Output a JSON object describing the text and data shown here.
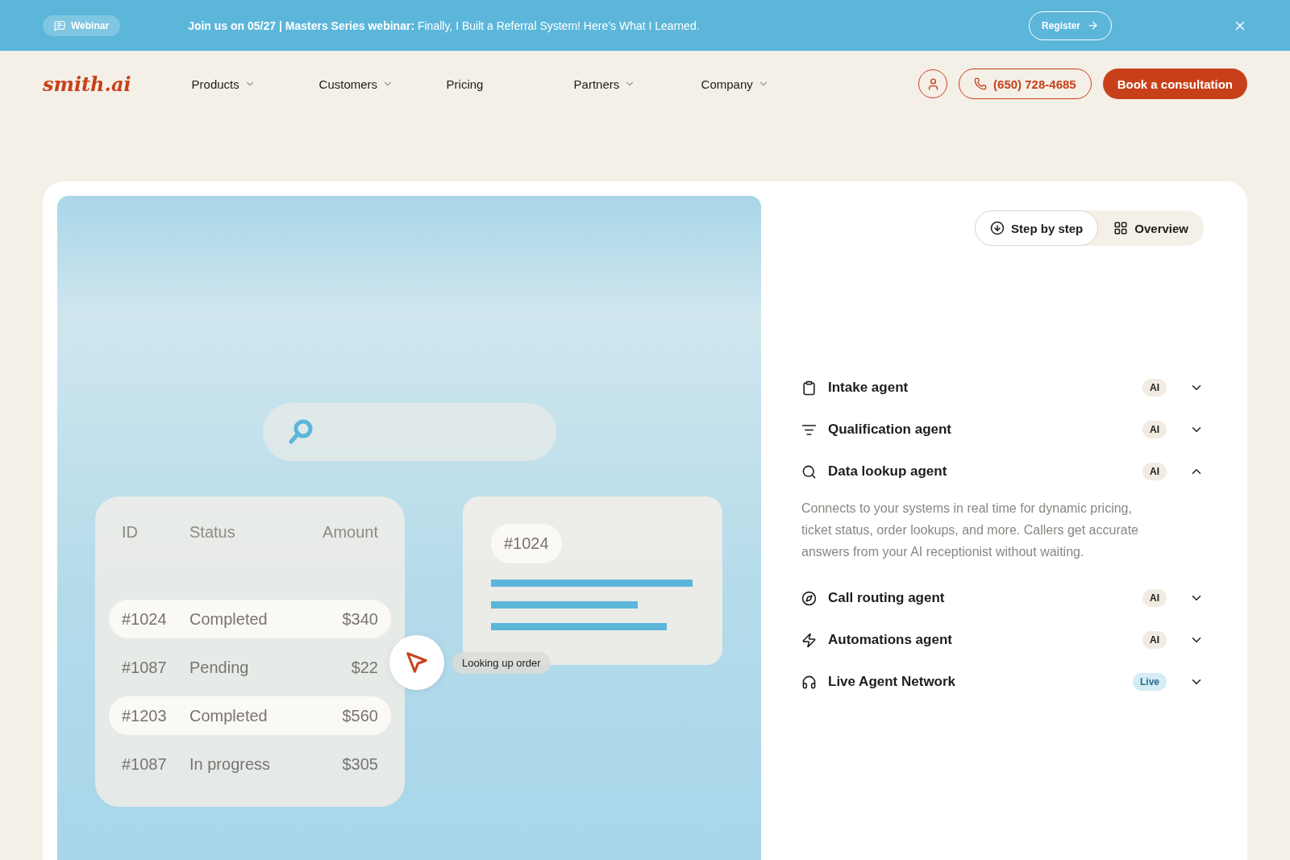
{
  "banner": {
    "badge": "Webinar",
    "message": "**Join us on 05/27 | Masters Series webinar:** Finally, I Built a Referral System! Here’s What I Learned.",
    "register": "Register"
  },
  "nav": {
    "logo": "smith.ai",
    "items": [
      {
        "label": "Products",
        "has_dropdown": true
      },
      {
        "label": "Customers",
        "has_dropdown": true
      },
      {
        "label": "Pricing",
        "has_dropdown": false
      },
      {
        "label": "Partners",
        "has_dropdown": true
      },
      {
        "label": "Company",
        "has_dropdown": true
      }
    ],
    "phone": "(650) 728-4685",
    "cta": "Book a consultation"
  },
  "illustration": {
    "table": {
      "columns": [
        "ID",
        "Status",
        "Amount"
      ],
      "rows": [
        {
          "cells": [
            "#1024",
            "Completed",
            "$340"
          ],
          "highlighted": true
        },
        {
          "cells": [
            "#1087",
            "Pending",
            "$22"
          ],
          "highlighted": false
        },
        {
          "cells": [
            "#1203",
            "Completed",
            "$560"
          ],
          "highlighted": true
        },
        {
          "cells": [
            "#1087",
            "In progress",
            "$305"
          ],
          "highlighted": false
        }
      ]
    },
    "detail_id": "#1024",
    "tooltip": "Looking up order"
  },
  "view_toggle": [
    {
      "label": "Step by step",
      "selected": true
    },
    {
      "label": "Overview",
      "selected": false
    }
  ],
  "agents": [
    {
      "name": "Intake agent",
      "badge": "AI",
      "kind": "ai",
      "expanded": false
    },
    {
      "name": "Qualification agent",
      "badge": "AI",
      "kind": "ai",
      "expanded": false
    },
    {
      "name": "Data lookup agent",
      "badge": "AI",
      "kind": "ai",
      "expanded": true,
      "description": "Connects to your systems in real time for dynamic pricing, ticket status, order lookups, and more. Callers get accurate answers from your AI receptionist without waiting."
    },
    {
      "name": "Call routing agent",
      "badge": "AI",
      "kind": "ai",
      "expanded": false
    },
    {
      "name": "Automations agent",
      "badge": "AI",
      "kind": "ai",
      "expanded": false
    },
    {
      "name": "Live Agent Network",
      "badge": "Live",
      "kind": "live",
      "expanded": false
    }
  ]
}
